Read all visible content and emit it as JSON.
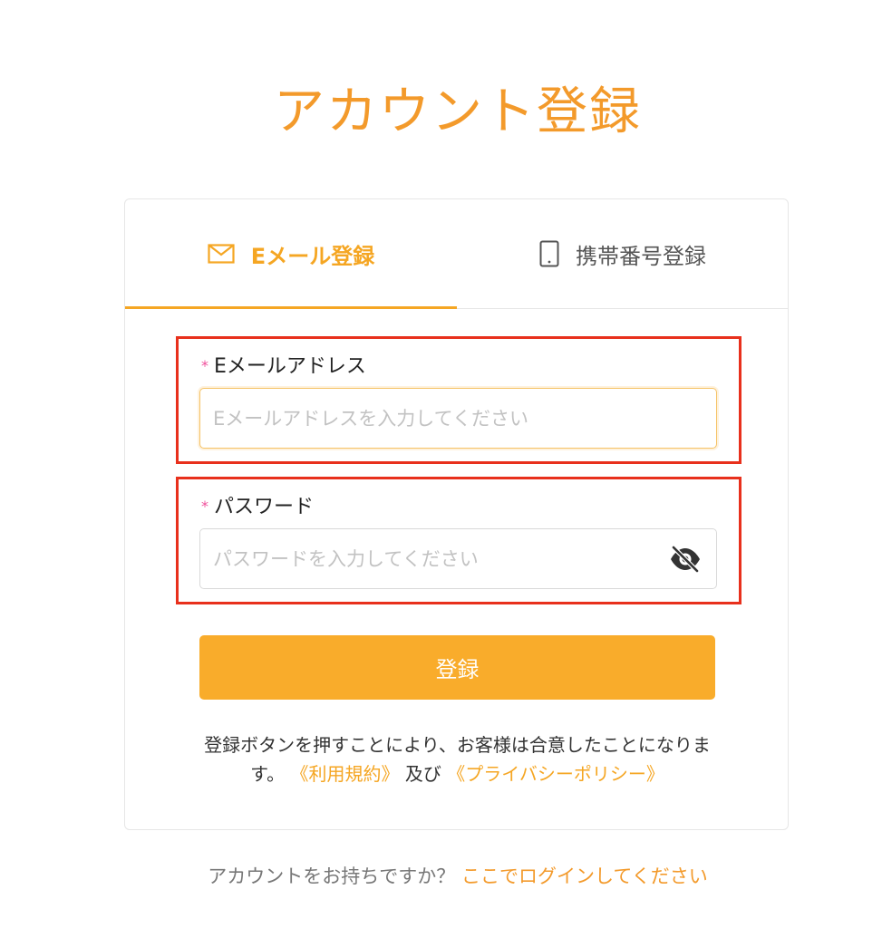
{
  "page": {
    "title": "アカウント登録"
  },
  "tabs": {
    "email": {
      "label": "Eメール登録",
      "icon": "mail-icon",
      "active": true
    },
    "phone": {
      "label": "携帯番号登録",
      "icon": "phone-icon",
      "active": false
    }
  },
  "form": {
    "email": {
      "required_mark": "*",
      "label": "Eメールアドレス",
      "value": "",
      "placeholder": "Eメールアドレスを入力してください"
    },
    "password": {
      "required_mark": "*",
      "label": "パスワード",
      "value": "",
      "placeholder": "パスワードを入力してください",
      "toggle_icon": "eye-off-icon"
    },
    "submit_label": "登録"
  },
  "agreement": {
    "text_before": "登録ボタンを押すことにより、お客様は合意したことになります。",
    "terms_link": "《利用規約》",
    "joiner": "及び",
    "privacy_link": "《プライバシーポリシー》"
  },
  "footer": {
    "prompt": "アカウントをお持ちですか？",
    "login_link": "ここでログインしてください"
  },
  "colors": {
    "accent": "#f5a623",
    "title": "#f39a2b",
    "button": "#f9ac2b",
    "required": "#f0509b",
    "highlight_box": "#e8301c"
  }
}
